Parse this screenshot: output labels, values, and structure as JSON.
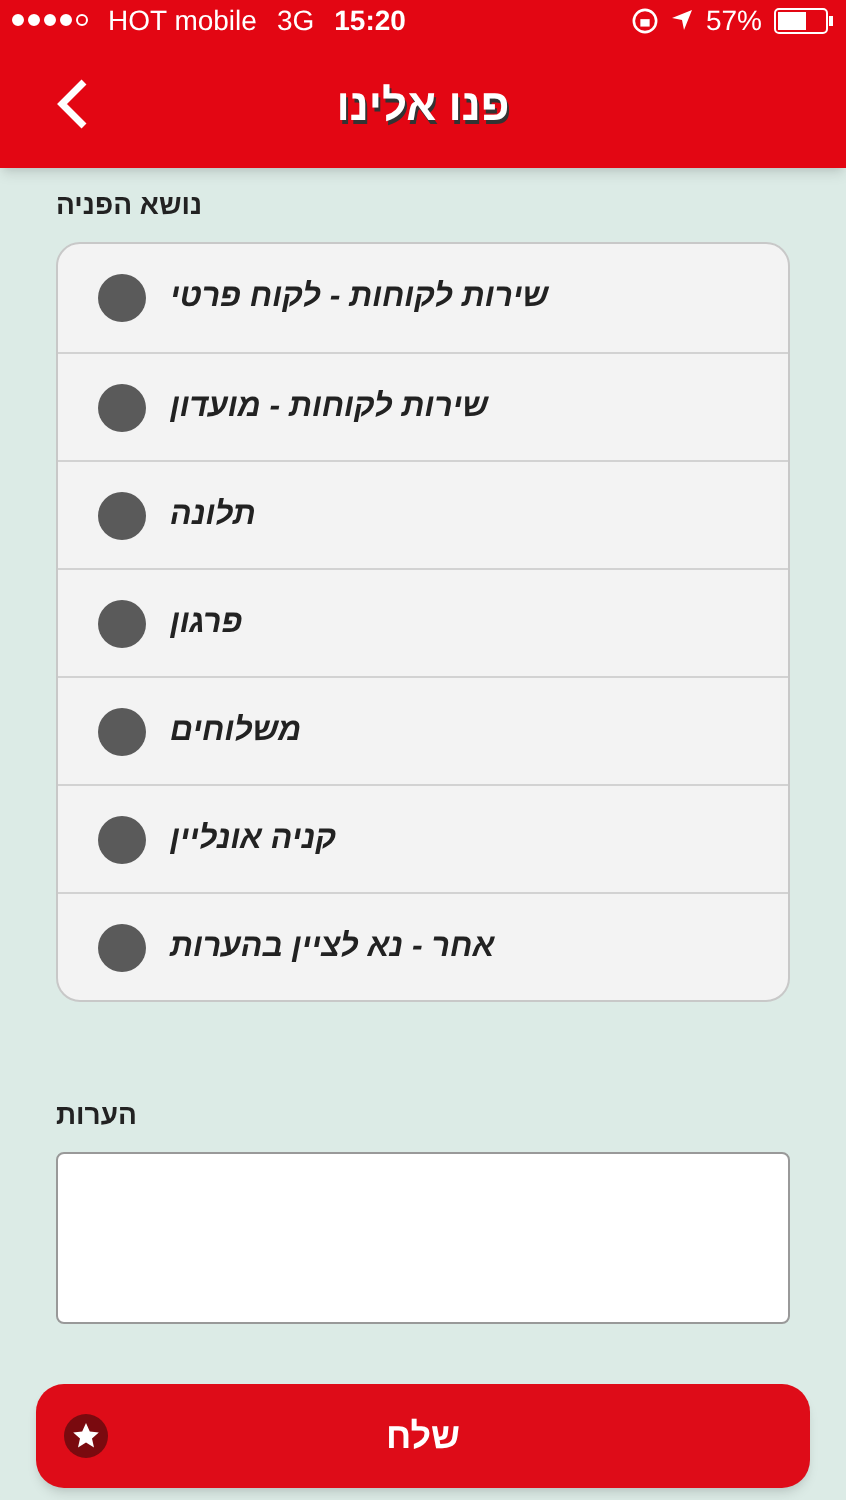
{
  "status_bar": {
    "carrier": "HOT mobile",
    "network": "3G",
    "time": "15:20",
    "battery": "57%"
  },
  "nav": {
    "title": "פנו אלינו"
  },
  "subject": {
    "label": "נושא הפניה",
    "options": [
      {
        "label": "שירות לקוחות - לקוח פרטי",
        "selected": false
      },
      {
        "label": "שירות לקוחות - מועדון",
        "selected": false
      },
      {
        "label": "תלונה",
        "selected": false
      },
      {
        "label": "פרגון",
        "selected": false
      },
      {
        "label": "משלוחים",
        "selected": false
      },
      {
        "label": "קניה אונליין",
        "selected": false
      },
      {
        "label": "אחר - נא לציין בהערות",
        "selected": false
      }
    ]
  },
  "notes": {
    "label": "הערות"
  },
  "send_button": {
    "label": "שלח"
  }
}
